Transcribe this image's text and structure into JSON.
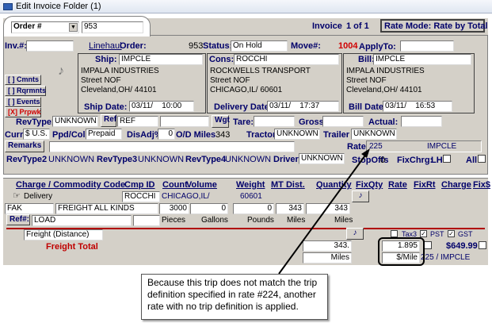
{
  "window": {
    "title": "Edit Invoice Folder (1)"
  },
  "header": {
    "order_select": "Order #",
    "order_number": "953",
    "invoice_label": "Invoice",
    "invoice_index": "1 of 1",
    "rate_mode_button": "Rate Mode: Rate by Total"
  },
  "row1": {
    "inv_label": "Inv.#:",
    "linehaul": "Linehaul",
    "order_label": "Order:",
    "order_value": "953",
    "status_label": "Status:",
    "status_value": "On Hold",
    "move_label": "Move#:",
    "move_value": "1004",
    "applyto_label": "ApplyTo:"
  },
  "side_buttons": [
    "Cmnts",
    "Rqrmnts",
    "Events",
    "Prpwk"
  ],
  "ship": {
    "title": "Ship:",
    "code": "IMPCLE",
    "name": "IMPALA INDUSTRIES",
    "street": "Street NOF",
    "city": "Cleveland,OH/ 44101",
    "date_label": "Ship Date:",
    "date": "03/11/",
    "time": "10:00"
  },
  "cons": {
    "title": "Cons:",
    "code": "ROCCHI",
    "name": "ROCKWELLS TRANSPORT",
    "street": "Street NOF",
    "city": "CHICAGO,IL/ 60601",
    "date_label": "Delivery Date:",
    "date": "03/11/",
    "time": "17:37"
  },
  "bill": {
    "title": "Bill:",
    "code": "IMPCLE",
    "name": "IMPALA INDUSTRIES",
    "street": "Street NOF",
    "city": "Cleveland,OH/ 44101",
    "date_label": "Bill Date:",
    "date": "03/11/",
    "time": "16:53"
  },
  "row_rev1": {
    "label": "RevType1",
    "value": "UNKNOWN",
    "ref_btn": "Ref",
    "ref_value": "REF",
    "wgt_btn": "Wgt",
    "tare_label": "Tare:",
    "gross_label": "Gross:",
    "actual_label": "Actual:"
  },
  "row_curr": {
    "curr_label": "Curr.",
    "curr_value": "$ U.S.",
    "ppd_label": "Ppd/Col",
    "ppd_value": "Prepaid",
    "disadj_label": "DisAdj%",
    "disadj_value": "0",
    "od_label": "O/D Miles",
    "od_value": "343",
    "tractor_label": "Tractor",
    "tractor_value": "UNKNOWN",
    "trailer_label": "Trailer",
    "trailer_value": "UNKNOWN"
  },
  "row_remarks": {
    "button": "Remarks",
    "rate_label": "Rate:",
    "rate_value": "225",
    "rate_company": "IMPCLE"
  },
  "row_rev2": {
    "rev2_label": "RevType2",
    "rev2": "UNKNOWN",
    "rev3_label": "RevType3",
    "rev3": "UNKNOWN",
    "rev4_label": "RevType4",
    "rev4": "UNKNOWN",
    "driver_label": "Driver",
    "driver": "UNKNOWN",
    "stopoffs_label": "StopOffs",
    "stopoffs": "0",
    "fixchrg_label": "FixChrg:",
    "lh_label": "LH",
    "all_label": "All"
  },
  "grid": {
    "headers": [
      "Charge / Commodity Code",
      "Cmp ID",
      "Count",
      "Volume",
      "Weight",
      "MT Dist.",
      "Quantity",
      "FixQty",
      "Rate",
      "FixRt",
      "Charge",
      "Fix$"
    ],
    "delivery": {
      "label": "Delivery",
      "cmp": "ROCCHI",
      "city": "CHICAGO,IL/",
      "zip": "60601"
    },
    "commodity": {
      "code": "FAK",
      "desc": "FREIGHT ALL KINDS",
      "count": "3000",
      "volume": "0",
      "weight": "0",
      "mt_dist": "343",
      "quantity": "343"
    },
    "units": {
      "ref_btn": "Ref#:",
      "ref_value": "LOAD",
      "count": "Pieces",
      "volume": "Gallons",
      "weight": "Pounds",
      "mt_dist": "Miles",
      "quantity": "Miles"
    },
    "charge": {
      "desc": "Freight (Distance)",
      "tax3": "Tax3",
      "pst": "PST",
      "gst": "GST"
    },
    "total": {
      "label": "Freight Total",
      "quantity": "343.",
      "rate": "1.895",
      "charge": "$649.99",
      "qty_unit": "Miles",
      "rate_unit": "$/Mile",
      "rate_ref": "225 / IMPCLE"
    }
  },
  "callout": {
    "text": "Because this trip does not match the trip definition specified in rate #224, another rate with no trip definition is applied."
  }
}
